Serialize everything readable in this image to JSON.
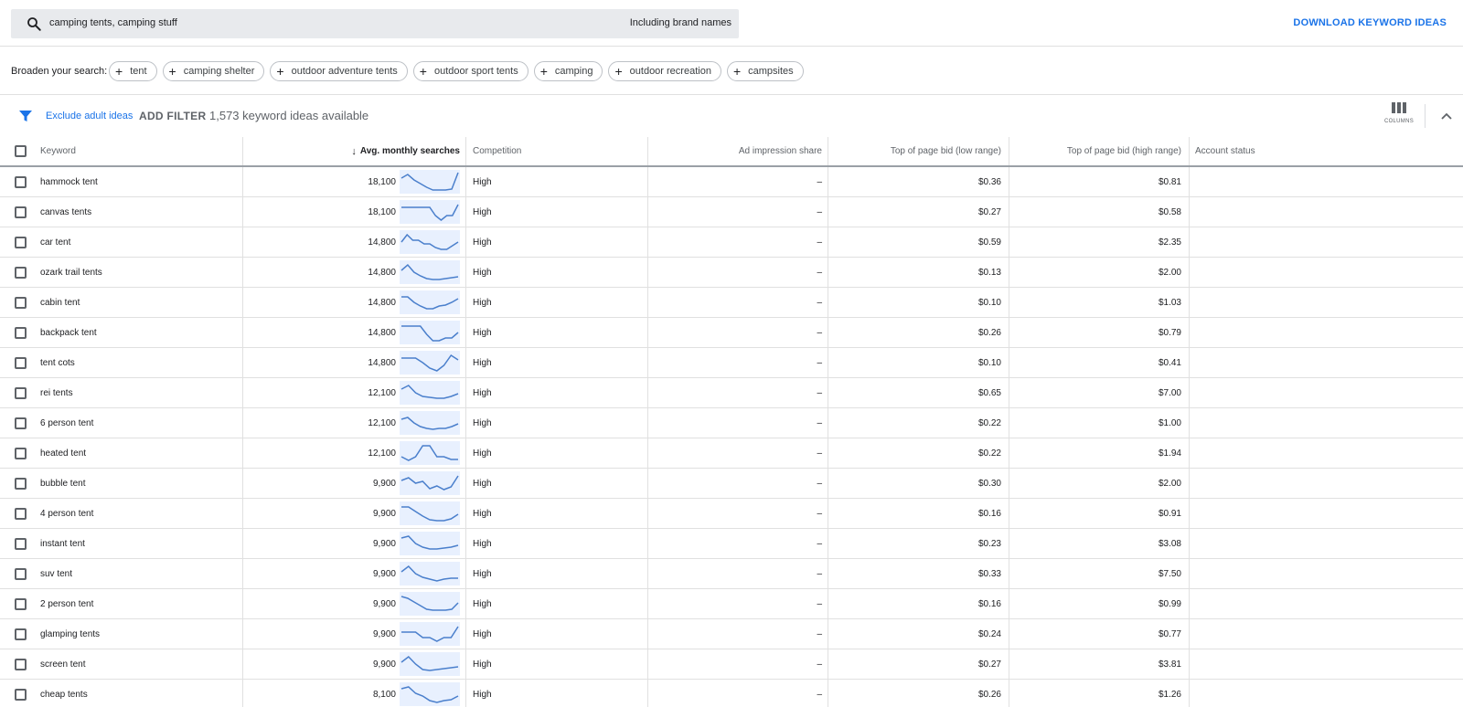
{
  "search": {
    "query": "camping tents, camping stuff",
    "brand_label": "Including brand names"
  },
  "download_label": "DOWNLOAD KEYWORD IDEAS",
  "broaden": {
    "label": "Broaden your search:",
    "chips": [
      "tent",
      "camping shelter",
      "outdoor adventure tents",
      "outdoor sport tents",
      "camping",
      "outdoor recreation",
      "campsites"
    ]
  },
  "filter": {
    "exclude_label": "Exclude adult ideas",
    "add_filter_label": "ADD FILTER",
    "available_text": "1,573 keyword ideas available",
    "columns_label": "COLUMNS"
  },
  "table": {
    "headers": {
      "keyword": "Keyword",
      "avg": "Avg. monthly searches",
      "competition": "Competition",
      "ad_share": "Ad impression share",
      "low_bid": "Top of page bid (low range)",
      "high_bid": "Top of page bid (high range)",
      "account": "Account status"
    },
    "sparkline_color": "#4a7fcc",
    "rows": [
      {
        "keyword": "hammock tent",
        "avg": "18,100",
        "competition": "High",
        "ad_share": "–",
        "low": "$0.36",
        "high": "$0.81",
        "trend": [
          0.7,
          0.9,
          0.6,
          0.4,
          0.2,
          0.05,
          0.05,
          0.05,
          0.1,
          1.0
        ]
      },
      {
        "keyword": "canvas tents",
        "avg": "18,100",
        "competition": "High",
        "ad_share": "–",
        "low": "$0.27",
        "high": "$0.58",
        "trend": [
          0.75,
          0.75,
          0.75,
          0.75,
          0.75,
          0.75,
          0.3,
          0.05,
          0.3,
          0.3,
          0.9
        ]
      },
      {
        "keyword": "car tent",
        "avg": "14,800",
        "competition": "High",
        "ad_share": "–",
        "low": "$0.59",
        "high": "$2.35",
        "trend": [
          0.5,
          0.9,
          0.6,
          0.6,
          0.4,
          0.4,
          0.2,
          0.1,
          0.1,
          0.3,
          0.5
        ]
      },
      {
        "keyword": "ozark trail tents",
        "avg": "14,800",
        "competition": "High",
        "ad_share": "–",
        "low": "$0.13",
        "high": "$2.00",
        "trend": [
          0.6,
          0.9,
          0.5,
          0.3,
          0.15,
          0.1,
          0.1,
          0.15,
          0.2,
          0.25
        ]
      },
      {
        "keyword": "cabin tent",
        "avg": "14,800",
        "competition": "High",
        "ad_share": "–",
        "low": "$0.10",
        "high": "$1.03",
        "trend": [
          0.8,
          0.8,
          0.5,
          0.3,
          0.15,
          0.15,
          0.3,
          0.35,
          0.5,
          0.7
        ]
      },
      {
        "keyword": "backpack tent",
        "avg": "14,800",
        "competition": "High",
        "ad_share": "–",
        "low": "$0.26",
        "high": "$0.79",
        "trend": [
          0.85,
          0.85,
          0.85,
          0.85,
          0.4,
          0.05,
          0.05,
          0.2,
          0.2,
          0.5
        ]
      },
      {
        "keyword": "tent cots",
        "avg": "14,800",
        "competition": "High",
        "ad_share": "–",
        "low": "$0.10",
        "high": "$0.41",
        "trend": [
          0.75,
          0.75,
          0.75,
          0.5,
          0.2,
          0.05,
          0.35,
          0.9,
          0.65
        ]
      },
      {
        "keyword": "rei tents",
        "avg": "12,100",
        "competition": "High",
        "ad_share": "–",
        "low": "$0.65",
        "high": "$7.00",
        "trend": [
          0.7,
          0.9,
          0.5,
          0.3,
          0.25,
          0.2,
          0.2,
          0.3,
          0.45
        ]
      },
      {
        "keyword": "6 person tent",
        "avg": "12,100",
        "competition": "High",
        "ad_share": "–",
        "low": "$0.22",
        "high": "$1.00",
        "trend": [
          0.7,
          0.8,
          0.5,
          0.3,
          0.2,
          0.15,
          0.2,
          0.2,
          0.3,
          0.45
        ]
      },
      {
        "keyword": "heated tent",
        "avg": "12,100",
        "competition": "High",
        "ad_share": "–",
        "low": "$0.22",
        "high": "$1.94",
        "trend": [
          0.3,
          0.1,
          0.3,
          0.9,
          0.9,
          0.3,
          0.3,
          0.15,
          0.15
        ]
      },
      {
        "keyword": "bubble tent",
        "avg": "9,900",
        "competition": "High",
        "ad_share": "–",
        "low": "$0.30",
        "high": "$2.00",
        "trend": [
          0.65,
          0.8,
          0.5,
          0.6,
          0.2,
          0.35,
          0.15,
          0.3,
          0.9
        ]
      },
      {
        "keyword": "4 person tent",
        "avg": "9,900",
        "competition": "High",
        "ad_share": "–",
        "low": "$0.16",
        "high": "$0.91",
        "trend": [
          0.85,
          0.85,
          0.6,
          0.35,
          0.15,
          0.1,
          0.1,
          0.2,
          0.45
        ]
      },
      {
        "keyword": "instant tent",
        "avg": "9,900",
        "competition": "High",
        "ad_share": "–",
        "low": "$0.23",
        "high": "$3.08",
        "trend": [
          0.8,
          0.9,
          0.5,
          0.3,
          0.2,
          0.2,
          0.25,
          0.3,
          0.4
        ]
      },
      {
        "keyword": "suv tent",
        "avg": "9,900",
        "competition": "High",
        "ad_share": "–",
        "low": "$0.33",
        "high": "$7.50",
        "trend": [
          0.6,
          0.9,
          0.5,
          0.3,
          0.2,
          0.1,
          0.2,
          0.25,
          0.25
        ]
      },
      {
        "keyword": "2 person tent",
        "avg": "9,900",
        "competition": "High",
        "ad_share": "–",
        "low": "$0.16",
        "high": "$0.99",
        "trend": [
          0.9,
          0.8,
          0.6,
          0.4,
          0.2,
          0.15,
          0.15,
          0.15,
          0.2,
          0.55
        ]
      },
      {
        "keyword": "glamping tents",
        "avg": "9,900",
        "competition": "High",
        "ad_share": "–",
        "low": "$0.24",
        "high": "$0.77",
        "trend": [
          0.6,
          0.6,
          0.6,
          0.3,
          0.3,
          0.1,
          0.3,
          0.3,
          0.9
        ]
      },
      {
        "keyword": "screen tent",
        "avg": "9,900",
        "competition": "High",
        "ad_share": "–",
        "low": "$0.27",
        "high": "$3.81",
        "trend": [
          0.6,
          0.9,
          0.5,
          0.2,
          0.15,
          0.2,
          0.25,
          0.3,
          0.35
        ]
      },
      {
        "keyword": "cheap tents",
        "avg": "8,100",
        "competition": "High",
        "ad_share": "–",
        "low": "$0.26",
        "high": "$1.26",
        "trend": [
          0.8,
          0.9,
          0.55,
          0.4,
          0.15,
          0.05,
          0.15,
          0.2,
          0.4
        ]
      }
    ]
  }
}
